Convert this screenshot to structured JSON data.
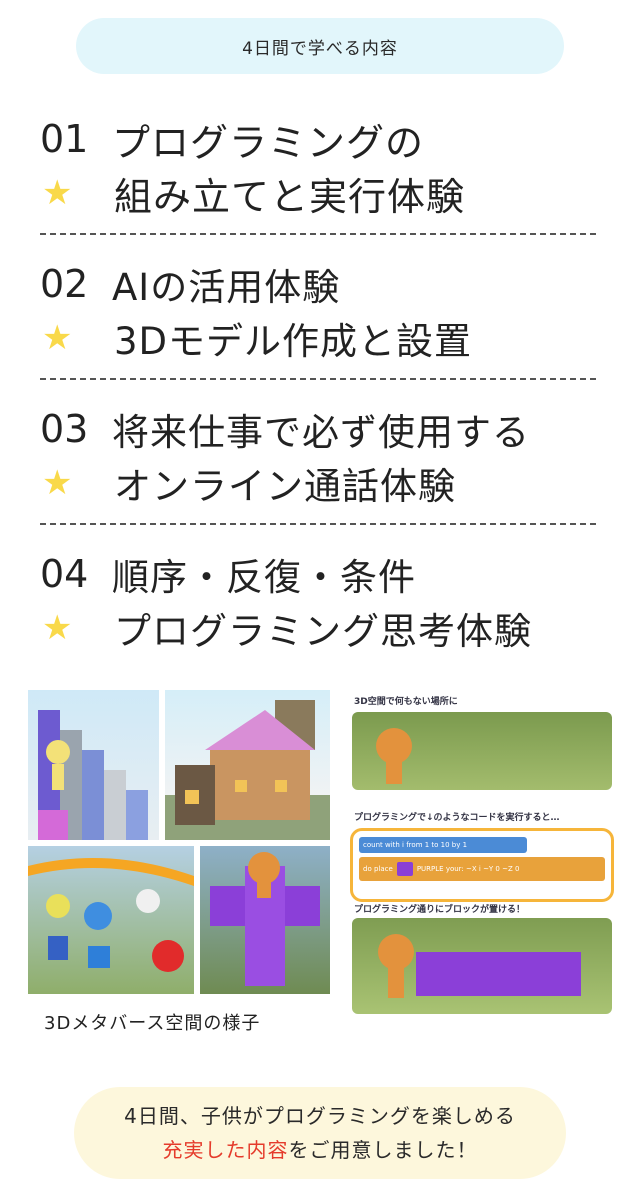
{
  "header": {
    "title": "4日間で学べる内容"
  },
  "items": [
    {
      "number": "01",
      "line1": "プログラミングの",
      "line2": "組み立てと実行体験"
    },
    {
      "number": "02",
      "line1": "AIの活用体験",
      "line2": "3Dモデル作成と設置"
    },
    {
      "number": "03",
      "line1": "将来仕事で必ず使用する",
      "line2": "オンライン通話体験"
    },
    {
      "number": "04",
      "line1": "順序・反復・条件",
      "line2": "プログラミング思考体験"
    }
  ],
  "star_symbol": "★",
  "photos": {
    "caption": "3Dメタバース空間の様子"
  },
  "code_panel": {
    "label1": "3D空間で何もない場所に",
    "label2": "プログラミングで↓のようなコードを実行すると…",
    "label3": "プログラミング通りにブロックが置ける！",
    "code_line1": "count with  i  from  1  to  10  by  1",
    "code_do": "do",
    "code_line2_place": "place",
    "code_line2_color": "PURPLE",
    "code_line2_rest": "your: ~X  i  ~Y  0  ~Z  0"
  },
  "footer": {
    "line1": "4日間、子供がプログラミングを楽しめる",
    "line2_highlight": "充実した内容",
    "line2_rest": "をご用意しました！"
  },
  "colors": {
    "star": "#f9d94a",
    "highlight": "#e53b2b",
    "header_bg": "#e2f6fb",
    "footer_bg": "#fdf7dc"
  }
}
